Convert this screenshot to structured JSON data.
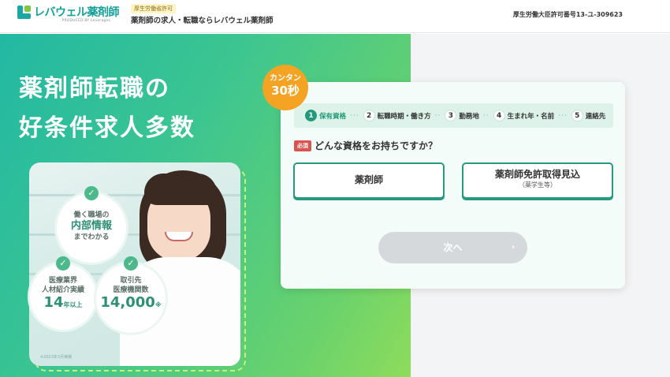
{
  "header": {
    "logo_text": "レバウェル薬剤師",
    "logo_sub": "PRODUCED BY Leverages",
    "license_badge": "厚生労働省許可",
    "tagline": "薬剤師の求人・転職ならレバウェル薬剤師",
    "license_number": "厚生労働大臣許可番号13-ユ-309623"
  },
  "hero": {
    "headline_line1": "薬剤師転職の",
    "headline_line2": "好条件求人多数",
    "photo_note": "※2023年3月実績",
    "bubbles": [
      {
        "line1": "働く職場の",
        "line2": "内部情報",
        "line3": "までわかる"
      },
      {
        "line1": "医療業界",
        "line2": "人材紹介実績",
        "value": "14",
        "unit": "年以上"
      },
      {
        "line1": "取引先",
        "line2": "医療機関数",
        "value": "14,000",
        "unit": "※"
      }
    ]
  },
  "form": {
    "easy_badge_line1": "カンタン",
    "easy_badge_line2": "30秒",
    "steps": [
      {
        "num": "1",
        "label": "保有資格",
        "active": true
      },
      {
        "num": "2",
        "label": "転職時期・働き方",
        "active": false
      },
      {
        "num": "3",
        "label": "勤務地",
        "active": false
      },
      {
        "num": "4",
        "label": "生まれ年・名前",
        "active": false
      },
      {
        "num": "5",
        "label": "連絡先",
        "active": false
      }
    ],
    "required_label": "必須",
    "question": "どんな資格をお持ちですか？",
    "option1": "薬剤師",
    "option2_main": "薬剤師免許取得見込",
    "option2_sub": "（薬学生等）",
    "next_label": "次へ",
    "next_arrow": "›"
  },
  "colors": {
    "brand": "#16a09a",
    "accent_green": "#229a7a",
    "badge_orange": "#f5a323",
    "required_red": "#d9534f"
  }
}
